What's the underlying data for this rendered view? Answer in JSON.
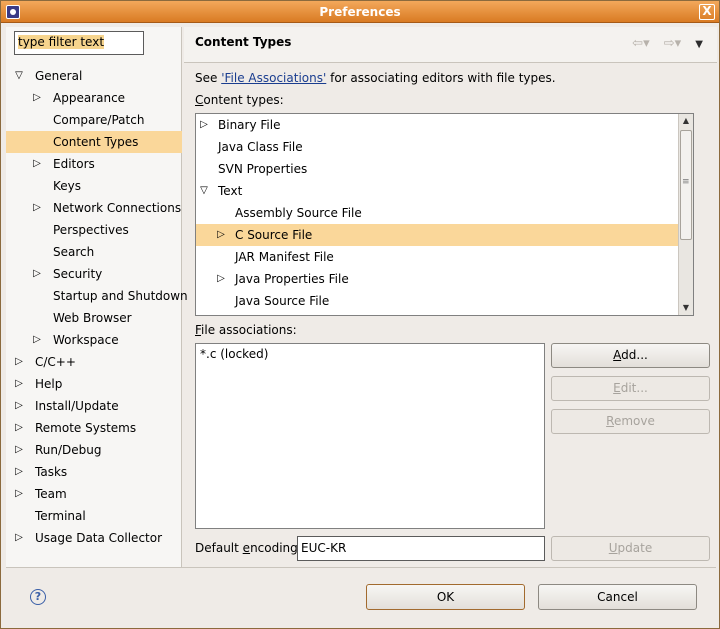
{
  "window": {
    "title": "Preferences",
    "close": "X"
  },
  "filter": {
    "value": "type filter text"
  },
  "tree": [
    {
      "label": "General",
      "level": 0,
      "state": "expanded",
      "selected": false
    },
    {
      "label": "Appearance",
      "level": 1,
      "state": "collapsed",
      "selected": false
    },
    {
      "label": "Compare/Patch",
      "level": 1,
      "state": "leaf",
      "selected": false
    },
    {
      "label": "Content Types",
      "level": 1,
      "state": "leaf",
      "selected": true
    },
    {
      "label": "Editors",
      "level": 1,
      "state": "collapsed",
      "selected": false
    },
    {
      "label": "Keys",
      "level": 1,
      "state": "leaf",
      "selected": false
    },
    {
      "label": "Network Connections",
      "level": 1,
      "state": "collapsed",
      "selected": false
    },
    {
      "label": "Perspectives",
      "level": 1,
      "state": "leaf",
      "selected": false
    },
    {
      "label": "Search",
      "level": 1,
      "state": "leaf",
      "selected": false
    },
    {
      "label": "Security",
      "level": 1,
      "state": "collapsed",
      "selected": false
    },
    {
      "label": "Startup and Shutdown",
      "level": 1,
      "state": "leaf",
      "selected": false
    },
    {
      "label": "Web Browser",
      "level": 1,
      "state": "leaf",
      "selected": false
    },
    {
      "label": "Workspace",
      "level": 1,
      "state": "collapsed",
      "selected": false
    },
    {
      "label": "C/C++",
      "level": 0,
      "state": "collapsed",
      "selected": false
    },
    {
      "label": "Help",
      "level": 0,
      "state": "collapsed",
      "selected": false
    },
    {
      "label": "Install/Update",
      "level": 0,
      "state": "collapsed",
      "selected": false
    },
    {
      "label": "Remote Systems",
      "level": 0,
      "state": "collapsed",
      "selected": false
    },
    {
      "label": "Run/Debug",
      "level": 0,
      "state": "collapsed",
      "selected": false
    },
    {
      "label": "Tasks",
      "level": 0,
      "state": "collapsed",
      "selected": false
    },
    {
      "label": "Team",
      "level": 0,
      "state": "collapsed",
      "selected": false
    },
    {
      "label": "Terminal",
      "level": 0,
      "state": "leaf",
      "selected": false
    },
    {
      "label": "Usage Data Collector",
      "level": 0,
      "state": "collapsed",
      "selected": false
    }
  ],
  "page": {
    "title": "Content Types",
    "intro_prefix": "See ",
    "intro_link": "'File Associations'",
    "intro_suffix": " for associating editors with file types.",
    "content_types_label_ul": "C",
    "content_types_label_rest": "ontent types:",
    "content_types": [
      {
        "label": "Binary File",
        "level": 0,
        "state": "collapsed",
        "selected": false
      },
      {
        "label": "Java Class File",
        "level": 0,
        "state": "leaf",
        "selected": false
      },
      {
        "label": "SVN Properties",
        "level": 0,
        "state": "leaf",
        "selected": false
      },
      {
        "label": "Text",
        "level": 0,
        "state": "expanded",
        "selected": false
      },
      {
        "label": "Assembly Source File",
        "level": 1,
        "state": "leaf",
        "selected": false
      },
      {
        "label": "C Source File",
        "level": 1,
        "state": "collapsed",
        "selected": true
      },
      {
        "label": "JAR Manifest File",
        "level": 1,
        "state": "leaf",
        "selected": false
      },
      {
        "label": "Java Properties File",
        "level": 1,
        "state": "collapsed",
        "selected": false
      },
      {
        "label": "Java Source File",
        "level": 1,
        "state": "leaf",
        "selected": false
      }
    ],
    "file_assoc_label_ul": "F",
    "file_assoc_label_rest": "ile associations:",
    "file_associations": [
      "*.c (locked)"
    ],
    "buttons": {
      "add_ul": "A",
      "add_rest": "dd...",
      "edit_ul": "E",
      "edit_rest": "dit...",
      "remove_ul": "R",
      "remove_rest": "emove",
      "update_ul": "U",
      "update_rest": "pdate"
    },
    "encoding_label_a": "Default ",
    "encoding_label_ul": "e",
    "encoding_label_b": "ncoding:",
    "encoding_value": "EUC-KR"
  },
  "footer": {
    "help": "?",
    "ok": "OK",
    "cancel": "Cancel"
  },
  "colors": {
    "selection": "#fad79a",
    "titlebar": "#e08a33",
    "link": "#1a3d8f"
  }
}
